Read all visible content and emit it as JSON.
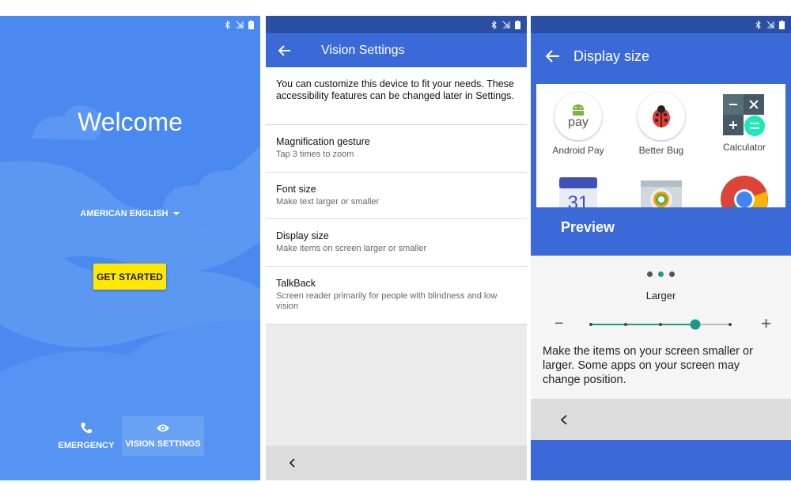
{
  "screen1": {
    "welcome": "Welcome",
    "language": "AMERICAN ENGLISH",
    "get_started": "GET STARTED",
    "emergency": "EMERGENCY",
    "vision_settings": "VISION SETTINGS"
  },
  "screen2": {
    "title": "Vision Settings",
    "intro": "You can customize this device to fit your needs. These accessibility features can be changed later in Settings.",
    "items": [
      {
        "title": "Magnification gesture",
        "subtitle": "Tap 3 times to zoom"
      },
      {
        "title": "Font size",
        "subtitle": "Make text larger or smaller"
      },
      {
        "title": "Display size",
        "subtitle": "Make items on screen larger or smaller"
      },
      {
        "title": "TalkBack",
        "subtitle": "Screen reader primarily for people with blindness and low vision"
      }
    ]
  },
  "screen3": {
    "title": "Display size",
    "apps": [
      "Android Pay",
      "Better Bug",
      "Calculator"
    ],
    "pay_text": "pay",
    "calendar_day": "31",
    "preview_label": "Preview",
    "size_label": "Larger",
    "minus": "−",
    "plus": "+",
    "description": "Make the items on your screen smaller or larger. Some apps on your screen may change position.",
    "slider": {
      "positions": 5,
      "selected_index": 3
    },
    "page_dots": {
      "count": 3,
      "active_index": 1
    }
  },
  "colors": {
    "blue": "#3b6ad8",
    "welcome_bg": "#4a8af0",
    "accent_teal": "#1b9a8a",
    "button_yellow": "#ffe800"
  }
}
